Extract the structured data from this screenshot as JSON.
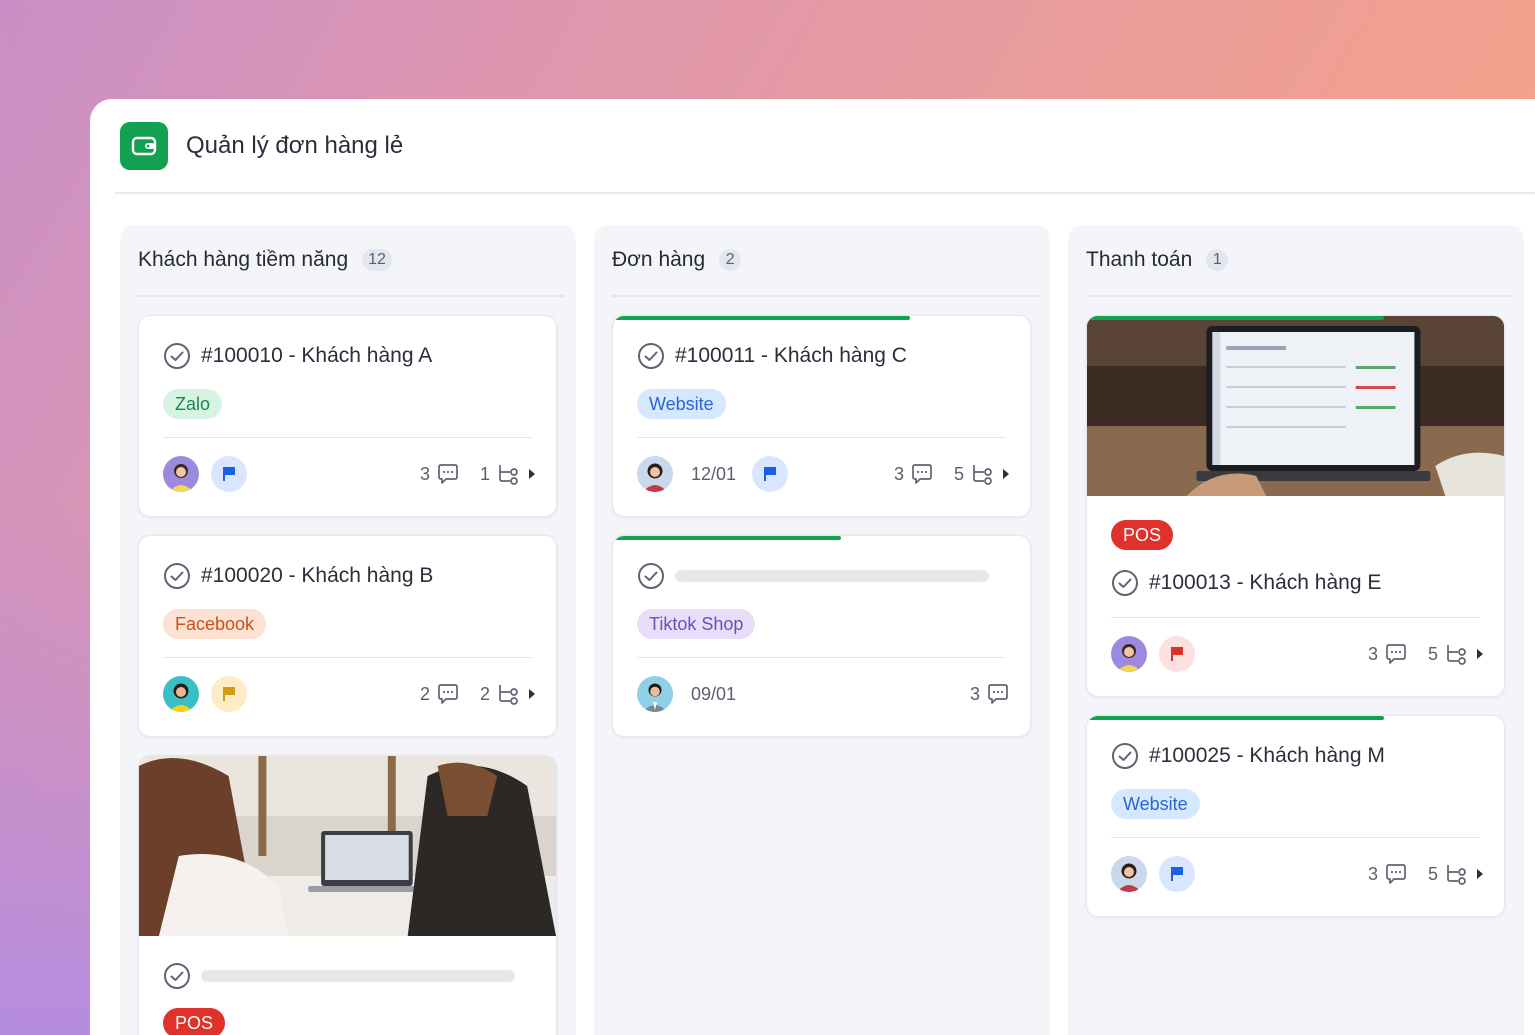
{
  "app": {
    "title": "Quản lý đơn hàng lẻ",
    "logo_icon": "wallet-icon",
    "accent": "#12a150"
  },
  "columns": [
    {
      "title": "Khách hàng tiềm năng",
      "count": "12",
      "cards": [
        {
          "title": "#100010 - Khách hàng A",
          "tag": "Zalo",
          "flag": "blue",
          "comments": "3",
          "subtasks": "1"
        },
        {
          "title": "#100020 - Khách hàng B",
          "tag": "Facebook",
          "flag": "yellow",
          "comments": "2",
          "subtasks": "2"
        },
        {
          "title": "",
          "tag": "POS",
          "has_image": true
        }
      ]
    },
    {
      "title": "Đơn hàng",
      "count": "2",
      "cards": [
        {
          "title": "#100011 - Khách hàng C",
          "tag": "Website",
          "date": "12/01",
          "flag": "blue",
          "comments": "3",
          "subtasks": "5",
          "progress": 0.7
        },
        {
          "title": "",
          "tag": "Tiktok Shop",
          "date": "09/01",
          "comments": "3",
          "progress": 0.55
        }
      ]
    },
    {
      "title": "Thanh toán",
      "count": "1",
      "cards": [
        {
          "title": "#100013 - Khách hàng E",
          "tag": "POS",
          "flag": "red",
          "comments": "3",
          "subtasks": "5",
          "has_image": true,
          "progress": 0.72
        },
        {
          "title": "#100025 - Khách hàng M",
          "tag": "Website",
          "flag": "blue",
          "comments": "3",
          "subtasks": "5",
          "progress": 0.72
        }
      ]
    }
  ],
  "colors": {
    "progress": "#11a34d",
    "tag_zalo": "#d7f3e2",
    "tag_facebook": "#fde1d2",
    "tag_website": "#d6e8ff",
    "tag_tiktok": "#e8defa",
    "tag_pos": "#e0322b"
  }
}
